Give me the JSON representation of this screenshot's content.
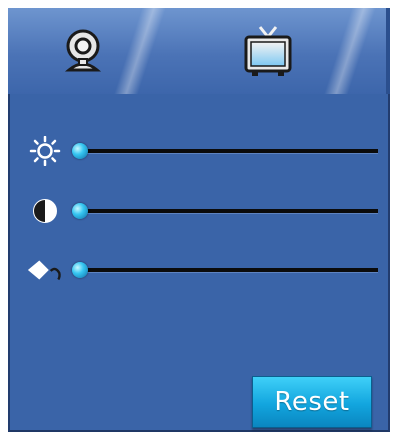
{
  "tabs": {
    "items": [
      {
        "id": "webcam",
        "icon": "webcam-icon"
      },
      {
        "id": "tv",
        "icon": "tv-icon"
      }
    ],
    "active": "tv"
  },
  "sliders": [
    {
      "id": "brightness",
      "icon": "brightness-icon",
      "value": 0.0
    },
    {
      "id": "contrast",
      "icon": "contrast-icon",
      "value": 0.0
    },
    {
      "id": "saturation",
      "icon": "color-fill-icon",
      "value": 0.0
    }
  ],
  "reset": {
    "label": "Reset"
  },
  "colors": {
    "panel": "#3a64a8",
    "track": "#0b0b0b",
    "thumb": "#36c6f1",
    "button": "#12a5de",
    "button_text": "#ffffff"
  }
}
